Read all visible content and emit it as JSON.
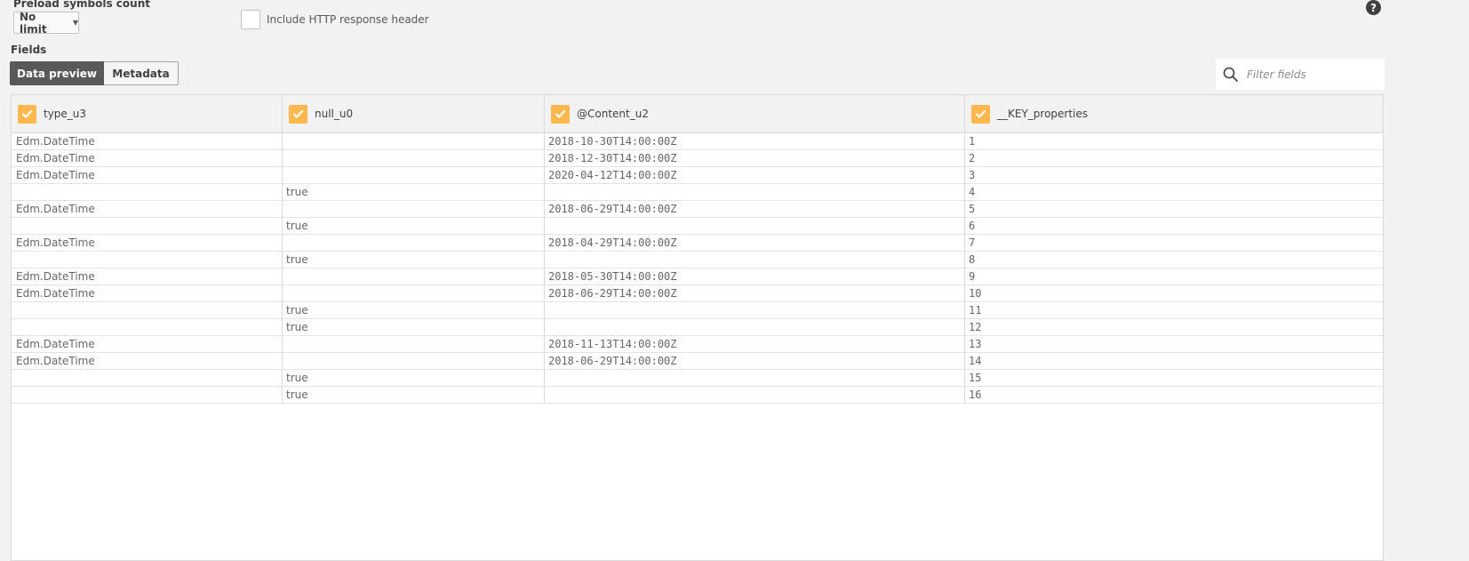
{
  "preload": {
    "label": "Preload symbols count",
    "selected": "No limit"
  },
  "http_header": {
    "label": "Include HTTP response header",
    "checked": false
  },
  "help_glyph": "?",
  "fields": {
    "label": "Fields",
    "tabs": [
      {
        "label": "Data preview",
        "active": true
      },
      {
        "label": "Metadata",
        "active": false
      }
    ],
    "filter_placeholder": "Filter fields"
  },
  "table": {
    "columns": [
      {
        "name": "type_u3",
        "checked": true
      },
      {
        "name": "null_u0",
        "checked": true
      },
      {
        "name": "@Content_u2",
        "checked": true
      },
      {
        "name": "__KEY_properties",
        "checked": true
      }
    ],
    "rows": [
      [
        "Edm.DateTime",
        "",
        "2018-10-30T14:00:00Z",
        "1"
      ],
      [
        "Edm.DateTime",
        "",
        "2018-12-30T14:00:00Z",
        "2"
      ],
      [
        "Edm.DateTime",
        "",
        "2020-04-12T14:00:00Z",
        "3"
      ],
      [
        "",
        "true",
        "",
        "4"
      ],
      [
        "Edm.DateTime",
        "",
        "2018-06-29T14:00:00Z",
        "5"
      ],
      [
        "",
        "true",
        "",
        "6"
      ],
      [
        "Edm.DateTime",
        "",
        "2018-04-29T14:00:00Z",
        "7"
      ],
      [
        "",
        "true",
        "",
        "8"
      ],
      [
        "Edm.DateTime",
        "",
        "2018-05-30T14:00:00Z",
        "9"
      ],
      [
        "Edm.DateTime",
        "",
        "2018-06-29T14:00:00Z",
        "10"
      ],
      [
        "",
        "true",
        "",
        "11"
      ],
      [
        "",
        "true",
        "",
        "12"
      ],
      [
        "Edm.DateTime",
        "",
        "2018-11-13T14:00:00Z",
        "13"
      ],
      [
        "Edm.DateTime",
        "",
        "2018-06-29T14:00:00Z",
        "14"
      ],
      [
        "",
        "true",
        "",
        "15"
      ],
      [
        "",
        "true",
        "",
        "16"
      ]
    ]
  },
  "colors": {
    "checkbox": "#ffb84d",
    "tab_active": "#595959",
    "help": "#404040"
  }
}
